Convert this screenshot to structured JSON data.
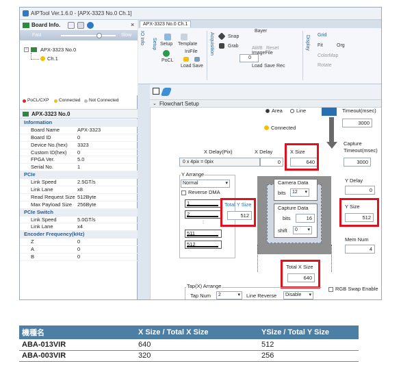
{
  "window": {
    "title": "AIPTool Ver.1.6.0 - [APX-3323 No.0 Ch.1]"
  },
  "left_panel": {
    "board_info_label": "Board Info.",
    "close_glyph": "×",
    "speed_fast": "Fast",
    "speed_slow": "Slow",
    "tree": {
      "board": "APX-3323 No.0",
      "channel": "Ch.1"
    },
    "legend": {
      "pocl": "PoCL/CXP",
      "connected": "Connected",
      "not_connected": "Not Connected"
    },
    "properties_title": "APX-3323 No.0",
    "properties": [
      {
        "type": "section",
        "label": "Information"
      },
      {
        "type": "item",
        "key": "Board Name",
        "value": "APX-3323"
      },
      {
        "type": "item",
        "key": "Board ID",
        "value": "0"
      },
      {
        "type": "item",
        "key": "Device No.(hex)",
        "value": "3323"
      },
      {
        "type": "item",
        "key": "Custom ID(hex)",
        "value": "0"
      },
      {
        "type": "item",
        "key": "FPGA Ver.",
        "value": "5.0"
      },
      {
        "type": "item",
        "key": "Serial No.",
        "value": "1"
      },
      {
        "type": "section",
        "label": "PCIe"
      },
      {
        "type": "item",
        "key": "Link Speed",
        "value": "2.5GT/s"
      },
      {
        "type": "item",
        "key": "Link Lane",
        "value": "x8"
      },
      {
        "type": "item",
        "key": "Read Request Size",
        "value": "512Byte"
      },
      {
        "type": "item",
        "key": "Max Payload Size",
        "value": "256Byte"
      },
      {
        "type": "section",
        "label": "PCIe Switch"
      },
      {
        "type": "item",
        "key": "Link Speed",
        "value": "5.0GT/s"
      },
      {
        "type": "item",
        "key": "Link Lane",
        "value": "x4"
      },
      {
        "type": "section",
        "label": "Encoder Frequency(kHz)"
      },
      {
        "type": "item",
        "key": "Z",
        "value": "0"
      },
      {
        "type": "item",
        "key": "A",
        "value": "0"
      },
      {
        "type": "item",
        "key": "B",
        "value": "0"
      }
    ]
  },
  "tab": {
    "label": "APX-3323 No.0 Ch.1"
  },
  "ribbon": {
    "io_info": "IO Info",
    "setup_group": "Setup",
    "setup": "Setup",
    "template": "Template",
    "inifile": "IniFile",
    "pocl": "PoCL",
    "load": "Load",
    "save": "Save",
    "acquisition_group": "Acquisition",
    "snap": "Snap",
    "grab": "Grab",
    "bayer": "Bayer",
    "awb": "AWB",
    "reset": "Reset",
    "spin_value": "0",
    "imagefile": "ImageFile",
    "load2": "Load",
    "save2": "Save",
    "rec": "Rec",
    "display_group": "Display",
    "grid": "Grid",
    "fit": "Fit",
    "org": "Org",
    "colormap": "ColorMap",
    "rotate": "Rotate"
  },
  "flowchart": {
    "title": "Flowchart Setup",
    "area": "Area",
    "line": "Line",
    "connected": "Connected",
    "timeout_top_label": "Timeout(msec)",
    "timeout_top_value": "3000",
    "x_delay_pix": "X Delay(Pix)",
    "x_delay_calc": "0 x 4pix = 0pix",
    "x_delay": "X Delay",
    "x_delay_value": "0",
    "x_size": "X Size",
    "x_size_value": "640",
    "capture_timeout": "Capture Timeout(msec)",
    "capture_timeout_value": "3000",
    "y_arrange": "Y Arrange",
    "y_arrange_value": "Normal",
    "reverse_dma": "Reverse DMA",
    "y_delay": "Y Delay",
    "y_delay_value": "0",
    "camera_data": "Camera Data",
    "bits": "bits",
    "camera_bits": "12",
    "total_y_size": "Total Y Size",
    "total_y_size_value": "512",
    "capture_data": "Capture Data",
    "capture_bits": "16",
    "shift": "shift",
    "shift_value": "0",
    "y_size": "Y Size",
    "y_size_value": "512",
    "mem_num": "Mem Num",
    "mem_num_value": "4",
    "lines": [
      "1",
      "2",
      "511",
      "512"
    ],
    "total_x_size": "Total X Size",
    "total_x_size_value": "640",
    "tap_arrange": "Tap(X) Arrange",
    "tap_num": "Tap Num",
    "tap_num_value": "2",
    "line_reverse": "Line Reverse",
    "line_reverse_value": "Disable",
    "rgb_swap": "RGB Swap Enable"
  },
  "table": {
    "headers": [
      "機種名",
      "X Size / Total X Size",
      "YSize / Total Y Size"
    ],
    "rows": [
      [
        "ABA-013VIR",
        "640",
        "512"
      ],
      [
        "ABA-003VIR",
        "320",
        "256"
      ]
    ]
  },
  "colors": {
    "highlight": "#e0101d",
    "table_header": "#4d7ea3",
    "accent": "#2f78c4"
  }
}
